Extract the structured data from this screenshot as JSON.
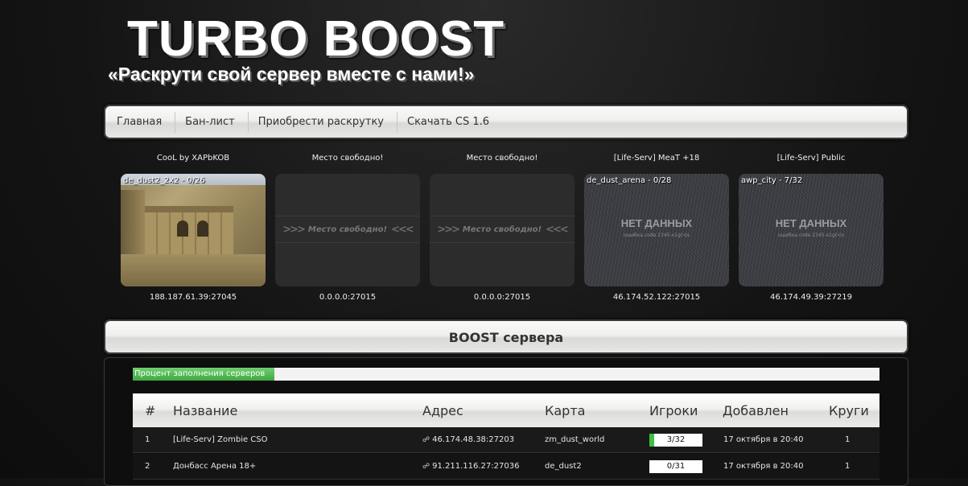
{
  "header": {
    "title": "TURBO BOOST",
    "slogan": "«Раскрути свой сервер вместе с нами!»"
  },
  "nav": {
    "items": [
      "Главная",
      "Бан-лист",
      "Приобрести раскрутку",
      "Скачать CS 1.6"
    ]
  },
  "servers": [
    {
      "name": "CooL by XAPbKOB",
      "map_label": "de_dust2_2x2 - 0/26",
      "ip": "188.187.61.39:27045",
      "thumb": "dust-map"
    },
    {
      "name": "Место свободно!",
      "banner": "Место свободно!",
      "ip": "0.0.0.0:27015",
      "thumb": "free-slot"
    },
    {
      "name": "Место свободно!",
      "banner": "Место свободно!",
      "ip": "0.0.0.0:27015",
      "thumb": "free-slot"
    },
    {
      "name": "[Life-Serv] MeaT +18",
      "map_label": "de_dust_arena - 0/28",
      "nodata": "НЕТ ДАННЫХ",
      "nodata_sub": "ошибка code 2345-x1g(ч)s",
      "ip": "46.174.52.122:27015",
      "thumb": "no-data"
    },
    {
      "name": "[Life-Serv] Public",
      "map_label": "awp_city - 7/32",
      "nodata": "НЕТ ДАННЫХ",
      "nodata_sub": "ошибка code 2345-x1g(ч)s",
      "ip": "46.174.49.39:27219",
      "thumb": "no-data"
    }
  ],
  "boost": {
    "title": "BOOST сервера",
    "fill_label": "Процент заполнения серверов",
    "fill_fraction": 0.19,
    "columns": [
      "#",
      "Название",
      "Адрес",
      "Карта",
      "Игроки",
      "Добавлен",
      "Круги"
    ],
    "rows": [
      {
        "num": "1",
        "name": "[Life-Serv] Zombie CSO",
        "address": "46.174.48.38:27203",
        "map": "zm_dust_world",
        "players": "3/32",
        "players_fraction": 0.09,
        "added": "17 октября в 20:40",
        "rounds": "1"
      },
      {
        "num": "2",
        "name": "Донбасс Арена 18+",
        "address": "91.211.116.27:27036",
        "map": "de_dust2",
        "players": "0/31",
        "players_fraction": 0,
        "added": "17 октября в 20:40",
        "rounds": "1"
      }
    ]
  },
  "colors": {
    "accent_green": "#3fa83f",
    "background": "#141414",
    "panel_light": "#f0f0ee"
  }
}
